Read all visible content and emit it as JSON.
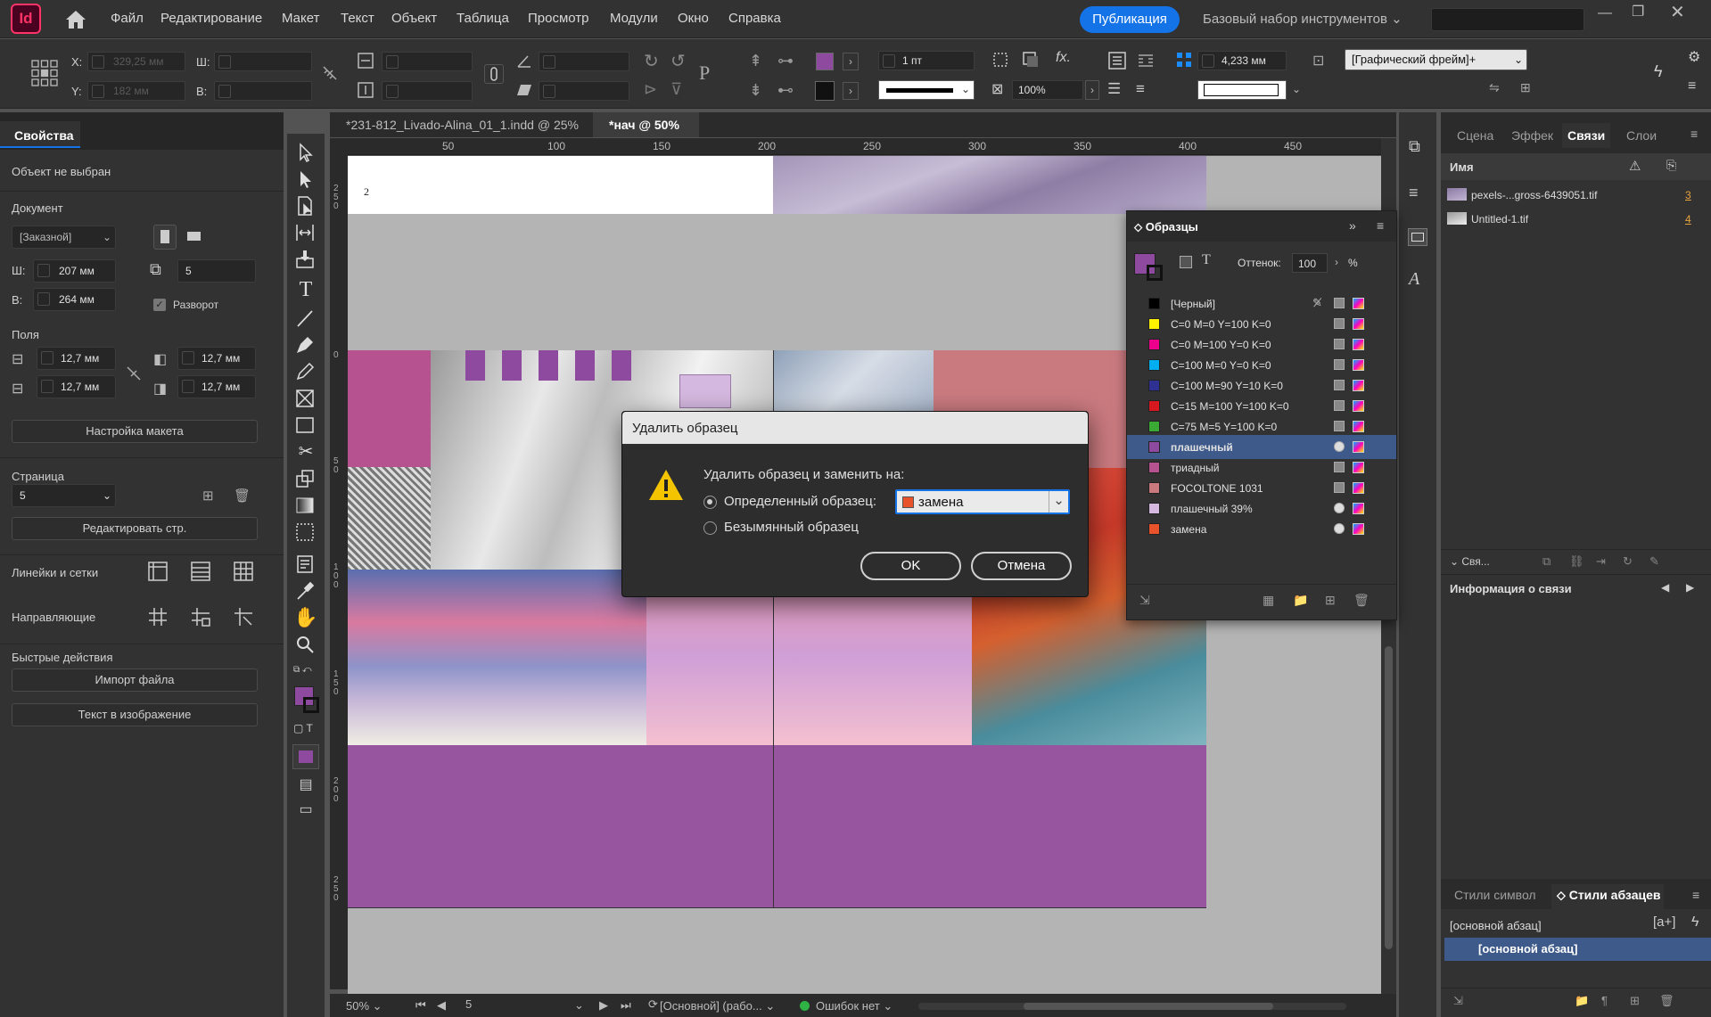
{
  "app": {
    "logo": "Id",
    "menu": [
      "Файл",
      "Редактирование",
      "Макет",
      "Текст",
      "Объект",
      "Таблица",
      "Просмотр",
      "Модули",
      "Окно",
      "Справка"
    ],
    "publish_label": "Публикация",
    "workspace": "Базовый набор инструментов"
  },
  "control_bar": {
    "x_label": "X:",
    "x_value": "329,25 мм",
    "y_label": "Y:",
    "y_value": "182 мм",
    "w_label": "Ш:",
    "h_label": "В:",
    "stroke_weight": "1 пт",
    "opacity": "100%",
    "gap": "4,233 мм",
    "object_style": "[Графический фрейм]+",
    "fill_color": "#8e4a9e"
  },
  "properties_panel": {
    "tab": "Свойства",
    "status": "Объект не выбран",
    "document_label": "Документ",
    "preset": "[Заказной]",
    "width_label": "Ш:",
    "width": "207 мм",
    "height_label": "В:",
    "height": "264 мм",
    "pages": "5",
    "facing_pages_label": "Разворот",
    "margins_label": "Поля",
    "margin_top": "12,7 мм",
    "margin_bottom": "12,7 мм",
    "margin_left": "12,7 мм",
    "margin_right": "12,7 мм",
    "layout_button": "Настройка макета",
    "page_label": "Страница",
    "page_value": "5",
    "edit_page_button": "Редактировать стр.",
    "rulers_label": "Линейки и сетки",
    "guides_label": "Направляющие",
    "quick_actions_label": "Быстрые действия",
    "import_button": "Импорт файла",
    "text_to_image_button": "Текст в изображение"
  },
  "document_tabs": [
    {
      "label": "*231-812_Livado-Alina_01_1.indd @ 25%",
      "active": false
    },
    {
      "label": "*нач @ 50%",
      "active": true
    }
  ],
  "ruler_marks": [
    "50",
    "100",
    "150",
    "200",
    "250",
    "300",
    "350",
    "400",
    "450"
  ],
  "left_ruler_marks": [
    "2 5 0",
    "0",
    "5 0",
    "1 0 0",
    "1 5 0",
    "2 0 0",
    "2 5 0"
  ],
  "page_number_text": "2",
  "status_bar": {
    "zoom": "50%",
    "page": "5",
    "style": "[Основной] (рабо...",
    "errors": "Ошибок нет"
  },
  "links_panel": {
    "tabs": [
      "Сцена",
      "Эффек",
      "Связи",
      "Слои"
    ],
    "active_tab": "Связи",
    "name_header": "Имя",
    "items": [
      {
        "name": "pexels-...gross-6439051.tif",
        "page": "3"
      },
      {
        "name": "Untitled-1.tif",
        "page": "4"
      }
    ],
    "collapsed_label": "Свя...",
    "info_label": "Информация о связи"
  },
  "styles_panel": {
    "tabs": [
      "Стили символ",
      "Стили абзацев"
    ],
    "active_tab": "Стили абзацев",
    "current": "[основной абзац]",
    "items": [
      "[основной абзац]"
    ]
  },
  "swatches_panel": {
    "title": "Образцы",
    "tint_label": "Оттенок:",
    "tint_value": "100",
    "percent": "%",
    "swatches": [
      {
        "name": "[Черный]",
        "color": "#000000"
      },
      {
        "name": "C=0 M=0 Y=100 K=0",
        "color": "#fff200"
      },
      {
        "name": "C=0 M=100 Y=0 K=0",
        "color": "#ec008c"
      },
      {
        "name": "C=100 M=0 Y=0 K=0",
        "color": "#00aeef"
      },
      {
        "name": "C=100 M=90 Y=10 K=0",
        "color": "#2e3192"
      },
      {
        "name": "C=15 M=100 Y=100 K=0",
        "color": "#d7191f"
      },
      {
        "name": "C=75 M=5 Y=100 K=0",
        "color": "#3aaa35"
      },
      {
        "name": "плашечный",
        "color": "#8e4a9e"
      },
      {
        "name": "триадный",
        "color": "#b5528f"
      },
      {
        "name": "FOCOLTONE 1031",
        "color": "#c97a7f"
      },
      {
        "name": "плашечный 39%",
        "color": "#d5b8df"
      },
      {
        "name": "замена",
        "color": "#e8532c"
      }
    ],
    "selected": "плашечный"
  },
  "dialog": {
    "title": "Удалить образец",
    "message": "Удалить образец и заменить на:",
    "option_defined": "Определенный образец:",
    "option_unnamed": "Безымянный образец",
    "selected_swatch": "замена",
    "selected_color": "#e8532c",
    "ok": "OK",
    "cancel": "Отмена"
  }
}
